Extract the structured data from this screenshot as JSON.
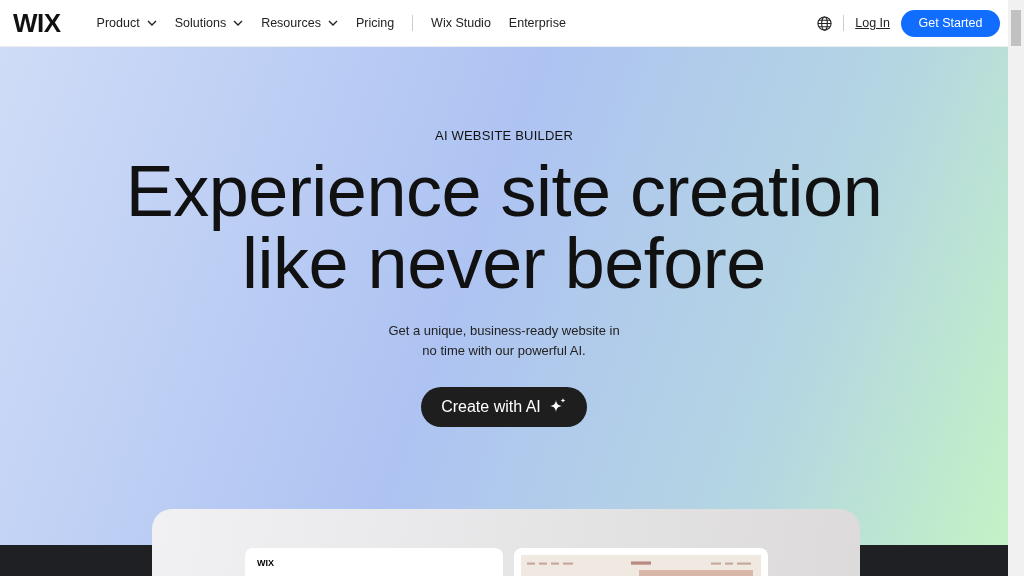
{
  "header": {
    "logo": "WIX",
    "nav": [
      {
        "label": "Product",
        "dropdown": true
      },
      {
        "label": "Solutions",
        "dropdown": true
      },
      {
        "label": "Resources",
        "dropdown": true
      },
      {
        "label": "Pricing",
        "dropdown": false
      },
      {
        "label": "Wix Studio",
        "dropdown": false
      },
      {
        "label": "Enterprise",
        "dropdown": false
      }
    ],
    "login": "Log In",
    "cta": "Get Started"
  },
  "hero": {
    "eyebrow": "AI WEBSITE BUILDER",
    "title_lines": [
      "Experience site creation",
      "like never before"
    ],
    "subtitle_lines": [
      "Get a unique, business-ready website in",
      "no time with our powerful AI."
    ],
    "button": "Create with AI"
  },
  "preview": {
    "editor_logo": "WIX"
  }
}
